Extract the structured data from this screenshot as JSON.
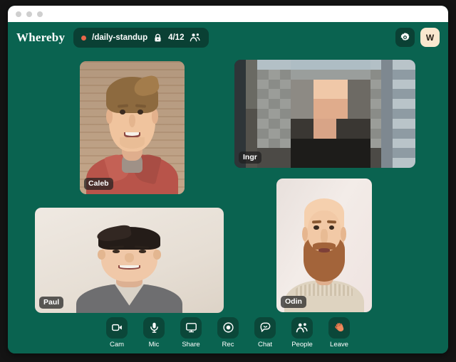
{
  "window": {
    "traffic_lights": [
      "close",
      "minimize",
      "maximize"
    ],
    "background_color": "#0a6350"
  },
  "header": {
    "logo": "Whereby",
    "room": {
      "recording_indicator": "rec-dot",
      "name": "/daily-standup",
      "lock_icon": "lock-icon",
      "count": "4/12",
      "people_icon": "people-icon"
    },
    "settings_label": "gear-icon",
    "avatar_initial": "W"
  },
  "stage": {
    "tiles": [
      {
        "id": "caleb",
        "name": "Caleb",
        "muted": false,
        "blurred": false
      },
      {
        "id": "ingrid",
        "name": "Ingr",
        "muted": false,
        "blurred": true
      },
      {
        "id": "paul",
        "name": "Paul",
        "muted": false,
        "blurred": false
      },
      {
        "id": "odin",
        "name": "Odin",
        "muted": false,
        "blurred": false
      }
    ]
  },
  "toolbar": {
    "items": [
      {
        "label": "Cam",
        "icon": "video-camera-icon"
      },
      {
        "label": "Mic",
        "icon": "microphone-icon"
      },
      {
        "label": "Share",
        "icon": "monitor-screen-icon"
      },
      {
        "label": "Rec",
        "icon": "record-circle-icon"
      },
      {
        "label": "Chat",
        "icon": "chat-bubble-icon"
      },
      {
        "label": "People",
        "icon": "people-group-icon"
      },
      {
        "label": "Leave",
        "icon": "waving-hand-icon"
      }
    ]
  },
  "colors": {
    "brand_green": "#0a6350",
    "pill_dark": "#0a4034",
    "rec_red": "#e8674a",
    "avatar_cream": "#fae8cf"
  }
}
